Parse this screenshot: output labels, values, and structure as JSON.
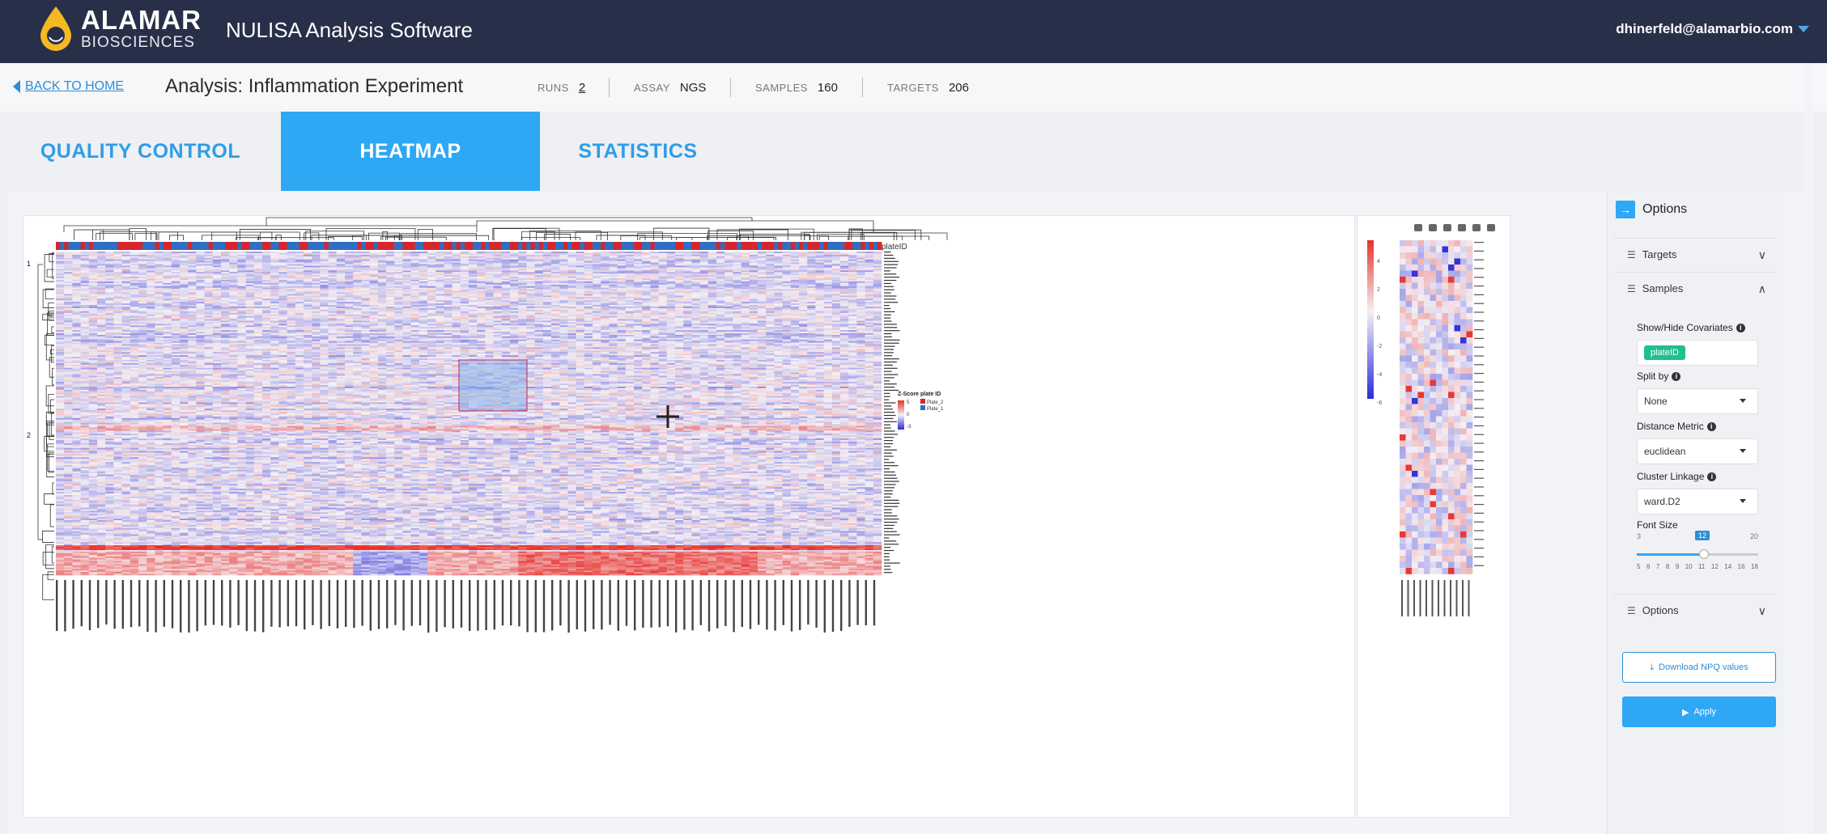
{
  "header": {
    "logo_line1": "ALAMAR",
    "logo_line2": "BIOSCIENCES",
    "app_title": "NULISA Analysis Software",
    "user_email": "dhinerfeld@alamarbio.com"
  },
  "subheader": {
    "back_label": "BACK TO HOME",
    "analysis_title": "Analysis: Inflammation Experiment",
    "runs_key": "RUNS",
    "runs_value": "2",
    "assay_key": "ASSAY",
    "assay_value": "NGS",
    "samples_key": "SAMPLES",
    "samples_value": "160",
    "targets_key": "TARGETS",
    "targets_value": "206"
  },
  "tabs": [
    {
      "label": "QUALITY CONTROL",
      "active": false
    },
    {
      "label": "HEATMAP",
      "active": true
    },
    {
      "label": "STATISTICS",
      "active": false
    }
  ],
  "heatmap": {
    "covariate_label": "plateID",
    "row_cluster_labels": [
      "1",
      "2"
    ],
    "legend_title": "Z-Score plate ID",
    "legend_ticks": [
      "5",
      "0",
      "-3"
    ],
    "legend_items": [
      "Plate_2",
      "Plate_1"
    ],
    "colors": {
      "high": "#e8302b",
      "mid": "#f4f0f5",
      "low": "#2b2bd8",
      "plate1": "#2f6fc2",
      "plate2": "#d6262b"
    }
  },
  "zoom_plot": {
    "colorbar_ticks": [
      "4",
      "2",
      "0",
      "-2",
      "-4",
      "-6"
    ],
    "toolbar_icons": [
      "camera-icon",
      "zoom-icon",
      "pan-icon",
      "zoom-in-icon",
      "zoom-out-icon",
      "home-icon"
    ]
  },
  "options": {
    "title": "Options",
    "targets": "Targets",
    "samples": "Samples",
    "show_hide_label": "Show/Hide Covariates",
    "covariate_chip": "plateID",
    "split_by_label": "Split by",
    "split_by_value": "None",
    "distance_label": "Distance Metric",
    "distance_value": "euclidean",
    "linkage_label": "Cluster Linkage",
    "linkage_value": "ward.D2",
    "font_size_label": "Font Size",
    "font_min": "3",
    "font_max": "20",
    "font_value": "12",
    "font_ticks": [
      "5",
      "6",
      "7",
      "8",
      "9",
      "10",
      "11",
      "12",
      "14",
      "16",
      "18"
    ],
    "options_sub": "Options",
    "download_label": "Download NPQ values",
    "apply_label": "Apply"
  }
}
